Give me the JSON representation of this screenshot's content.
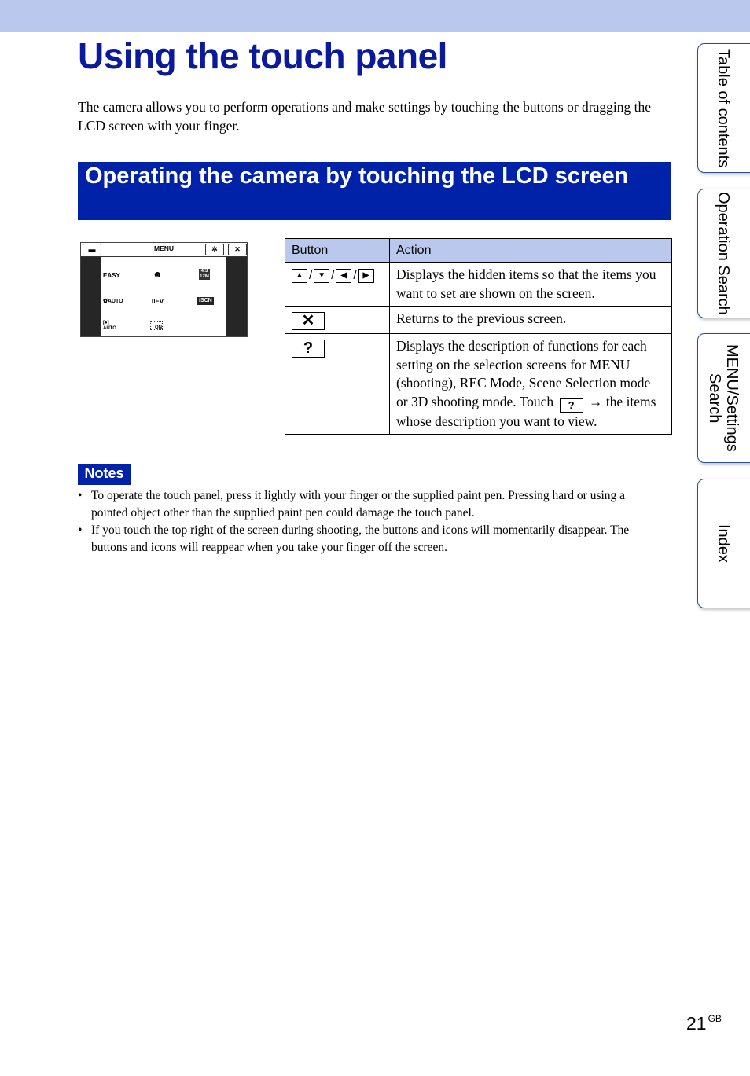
{
  "page": {
    "title": "Using the touch panel",
    "intro": "The camera allows you to perform operations and make settings by touching the buttons or dragging the LCD screen with your finger.",
    "section_heading": "Operating the camera by touching the LCD screen",
    "page_number": "21",
    "page_suffix": "GB"
  },
  "lcd_screen": {
    "menu_label": "MENU",
    "left_icon": "briefcase-icon",
    "settings_icon": "gear-icon",
    "close_icon": "close-icon",
    "items": [
      {
        "label": "EASY",
        "icon": "easy-mode"
      },
      {
        "label": "☻",
        "icon": "smile-shutter-icon"
      },
      {
        "label": "4:3 12M",
        "icon": "image-size-icon"
      },
      {
        "label": "✿AUTO",
        "icon": "macro-auto-icon"
      },
      {
        "label": "0EV",
        "icon": "exposure-icon"
      },
      {
        "label": "iSCN",
        "icon": "scene-recognition-icon"
      },
      {
        "label": "[●] AUTO",
        "icon": "focus-auto-icon"
      },
      {
        "label": "ON",
        "icon": "grid-line-icon"
      }
    ]
  },
  "table": {
    "headers": [
      "Button",
      "Action"
    ],
    "rows": [
      {
        "buttons": [
          "▲",
          "▼",
          "◀",
          "▶"
        ],
        "separator": "/",
        "action": "Displays the hidden items so that the items you want to set are shown on the screen."
      },
      {
        "buttons": [
          "✕"
        ],
        "action": "Returns to the previous screen."
      },
      {
        "buttons": [
          "?"
        ],
        "action_part1": "Displays the description of functions for each setting on the selection screens for MENU (shooting), REC Mode, Scene Selection mode or 3D shooting mode. Touch",
        "inline_button": "?",
        "arrow": "→",
        "action_part2": "the items whose description you want to view."
      }
    ]
  },
  "notes": {
    "label": "Notes",
    "bullet": "•",
    "items": [
      "To operate the touch panel, press it lightly with your finger or the supplied paint pen. Pressing hard or using a pointed object other than the supplied paint pen could damage the touch panel.",
      "If you touch the top right of the screen during shooting, the buttons and icons will momentarily disappear. The buttons and icons will reappear when you take your finger off the screen."
    ]
  },
  "side_tabs": [
    {
      "label": "Table of contents"
    },
    {
      "label": "Operation Search"
    },
    {
      "label": "MENU/Settings Search"
    },
    {
      "label": "Index"
    }
  ]
}
